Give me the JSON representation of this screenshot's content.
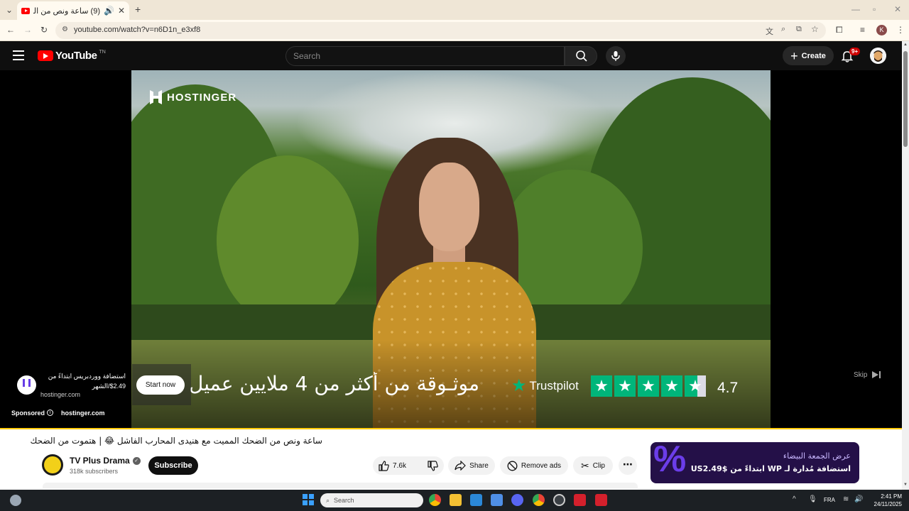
{
  "browser": {
    "tab_title": "(9) ساعة ونص من الضحك الـ",
    "url": "youtube.com/watch?v=n6D1n_e3xf8"
  },
  "youtube": {
    "logo_text": "YouTube",
    "logo_country": "TN",
    "search_placeholder": "Search",
    "create_label": "Create",
    "notifications_badge": "9+"
  },
  "ad": {
    "brand_logo": "HOSTINGER",
    "headline_arabic": "موثـوقة من أكثر من 4 ملايين عميل",
    "trustpilot_label": "Trustpilot",
    "trustpilot_score": "4.7",
    "cta_label": "Start now",
    "title": "استضافة ووردبريس ابتداءً من 2.49$/الشهر",
    "domain": "hostinger.com",
    "sponsored_label": "Sponsored",
    "sponsored_domain": "hostinger.com",
    "skip_label": "Skip"
  },
  "video": {
    "title": "ساعة ونص من الضحك المميت مع هنيدى المحارب الفاشل 😂 | هتموت من الضحك",
    "channel_name": "TV Plus Drama",
    "subscribers": "318k subscribers",
    "subscribe_label": "Subscribe",
    "like_count": "7.6k",
    "share_label": "Share",
    "remove_ads_label": "Remove ads",
    "clip_label": "Clip"
  },
  "promo": {
    "line1": "عرض الجمعة البيضاء",
    "line2": "استضافة مُدارة لـ WP ابتداءً من US2.49$"
  },
  "taskbar": {
    "search_placeholder": "Search",
    "language": "FRA",
    "time": "2:41 PM",
    "date": "24/11/2025"
  }
}
